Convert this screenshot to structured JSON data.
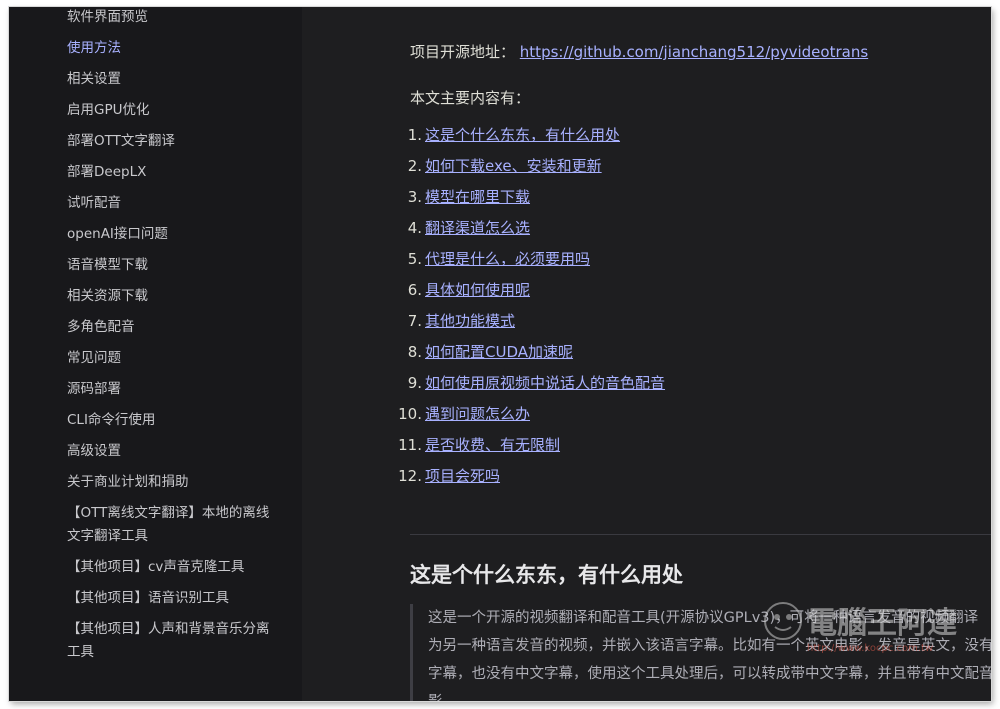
{
  "sidebar": {
    "items": [
      {
        "label": "软件界面预览",
        "active": false
      },
      {
        "label": "使用方法",
        "active": true
      },
      {
        "label": "相关设置",
        "active": false
      },
      {
        "label": "启用GPU优化",
        "active": false
      },
      {
        "label": "部署OTT文字翻译",
        "active": false
      },
      {
        "label": "部署DeepLX",
        "active": false
      },
      {
        "label": "试听配音",
        "active": false
      },
      {
        "label": "openAI接口问题",
        "active": false
      },
      {
        "label": "语音模型下载",
        "active": false
      },
      {
        "label": "相关资源下载",
        "active": false
      },
      {
        "label": "多角色配音",
        "active": false
      },
      {
        "label": "常见问题",
        "active": false
      },
      {
        "label": "源码部署",
        "active": false
      },
      {
        "label": "CLI命令行使用",
        "active": false
      },
      {
        "label": "高级设置",
        "active": false
      },
      {
        "label": "关于商业计划和捐助",
        "active": false
      },
      {
        "label": "【OTT离线文字翻译】本地的离线文字翻译工具",
        "active": false
      },
      {
        "label": "【其他项目】cv声音克隆工具",
        "active": false
      },
      {
        "label": "【其他项目】语音识别工具",
        "active": false
      },
      {
        "label": "【其他项目】人声和背景音乐分离工具",
        "active": false
      }
    ]
  },
  "main": {
    "repo_label": "项目开源地址：",
    "repo_url": "https://github.com/jianchang512/pyvideotrans",
    "intro": "本文主要内容有：",
    "toc": [
      {
        "num": "1.",
        "text": "这是个什么东东，有什么用处"
      },
      {
        "num": "2.",
        "text": "如何下载exe、安装和更新"
      },
      {
        "num": "3.",
        "text": "模型在哪里下载"
      },
      {
        "num": "4.",
        "text": "翻译渠道怎么选"
      },
      {
        "num": "5.",
        "text": "代理是什么，必须要用吗"
      },
      {
        "num": "6.",
        "text": "具体如何使用呢"
      },
      {
        "num": "7.",
        "text": "其他功能模式"
      },
      {
        "num": "8.",
        "text": "如何配置CUDA加速呢"
      },
      {
        "num": "9.",
        "text": "如何使用原视频中说话人的音色配音"
      },
      {
        "num": "10.",
        "text": "遇到问题怎么办"
      },
      {
        "num": "11.",
        "text": "是否收费、有无限制"
      },
      {
        "num": "12.",
        "text": "项目会死吗"
      }
    ],
    "section_heading": "这是个什么东东，有什么用处",
    "paragraph_lines": [
      "这是一个开源的视频翻译和配音工具(开源协议GPLv3)，可将一种语言发音的视频翻译",
      "为另一种语言发音的视频，并嵌入该语言字幕。比如有一个英文电影，发音是英文，没有英文",
      "字幕，也没有中文字幕，使用这个工具处理后，可以转成带中文字幕，并且带有中文配音的电",
      "影。"
    ]
  },
  "watermark": {
    "text": "電腦王阿達",
    "url": "http://www.kocpc.com.tw"
  },
  "colors": {
    "accent_link": "#a8b1ff",
    "background": "#1e1e20",
    "sidebar_bg": "#18181b"
  }
}
